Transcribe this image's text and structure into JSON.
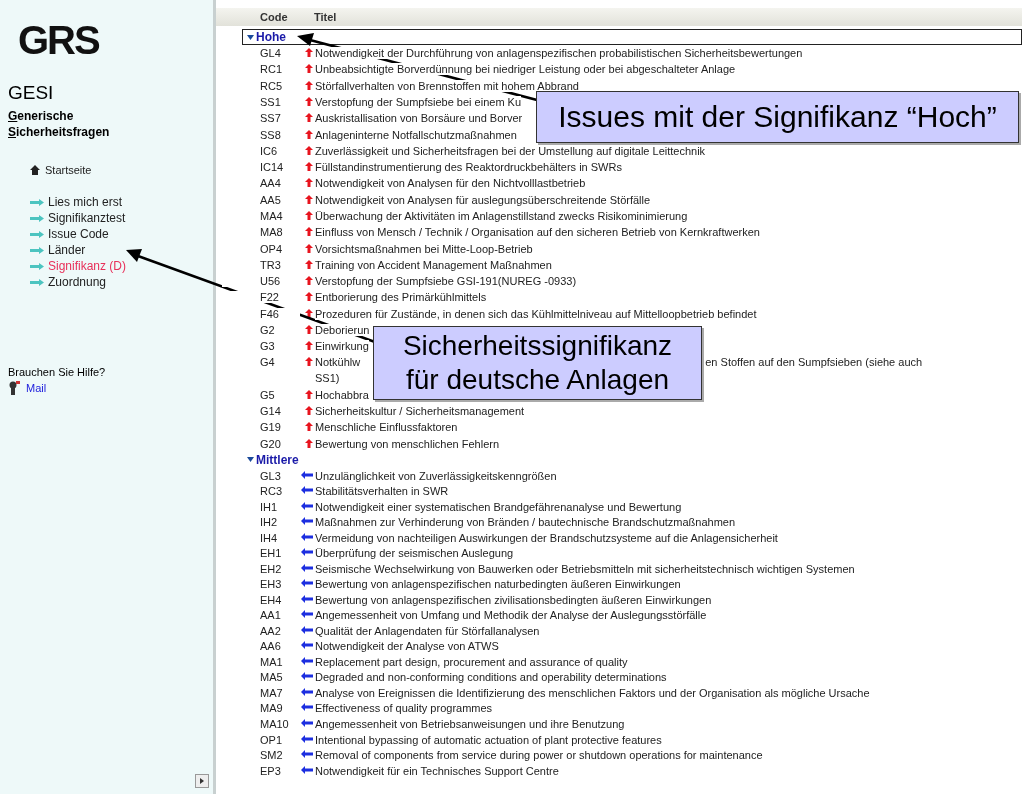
{
  "sidebar": {
    "logo": "GRS",
    "app_title": "GESI",
    "subtitle": [
      {
        "key": "G",
        "rest": "enerische"
      },
      {
        "key": "S",
        "rest": "icherheitsfragen"
      }
    ],
    "home": {
      "label": "Startseite"
    },
    "nav_items": [
      {
        "label": "Lies mich erst",
        "selected": false
      },
      {
        "label": "Signifikanztest",
        "selected": false
      },
      {
        "label": "Issue Code",
        "selected": false
      },
      {
        "label": "Länder",
        "selected": false
      },
      {
        "label": "Signifikanz (D)",
        "selected": true
      },
      {
        "label": "Zuordnung",
        "selected": false
      }
    ],
    "help": {
      "question": "Brauchen Sie Hilfe?",
      "link": "Mail"
    }
  },
  "table": {
    "columns": [
      "Code",
      "Titel"
    ],
    "groups": [
      {
        "label": "Hohe",
        "kind": "high",
        "selected": true,
        "rows": [
          {
            "code": "GL4",
            "title": "Notwendigkeit der Durchführung von anlagenspezifischen probabilistischen Sicherheitsbewertungen"
          },
          {
            "code": "RC1",
            "title": "Unbeabsichtigte Borverdünnung bei niedriger Leistung oder bei abgeschalteter Anlage"
          },
          {
            "code": "RC5",
            "title": "Störfallverhalten von Brennstoffen mit hohem Abbrand"
          },
          {
            "code": "SS1",
            "title": "Verstopfung der Sumpfsiebe bei einem Ku"
          },
          {
            "code": "SS7",
            "title": "Auskristallisation von Borsäure und Borver"
          },
          {
            "code": "SS8",
            "title": "Anlageninterne Notfallschutzmaßnahmen"
          },
          {
            "code": "IC6",
            "title": "Zuverlässigkeit und Sicherheitsfragen bei der Umstellung auf digitale Leittechnik"
          },
          {
            "code": "IC14",
            "title": "Füllstandinstrumentierung des Reaktordruckbehälters in SWRs"
          },
          {
            "code": "AA4",
            "title": "Notwendigkeit von Analysen für den Nichtvolllastbetrieb"
          },
          {
            "code": "AA5",
            "title": "Notwendigkeit von  Analysen für auslegungsüberschreitende Störfälle"
          },
          {
            "code": "MA4",
            "title": "Überwachung der Aktivitäten im Anlagenstillstand zwecks Risikominimierung"
          },
          {
            "code": "MA8",
            "title": "Einfluss von Mensch / Technik / Organisation auf den sicheren Betrieb von Kernkraftwerken"
          },
          {
            "code": "OP4",
            "title": "Vorsichtsmaßnahmen bei Mitte-Loop-Betrieb"
          },
          {
            "code": "TR3",
            "title": "Training von Accident Management Maßnahmen"
          },
          {
            "code": "U56",
            "title": "Verstopfung der Sumpfsiebe GSI-191(NUREG -0933)"
          },
          {
            "code": "F22",
            "title": "Entborierung des Primärkühlmittels"
          },
          {
            "code": "F46",
            "title": "Prozeduren für Zustände, in denen sich das Kühlmittelniveau auf Mittelloopbetrieb befindet"
          },
          {
            "code": "G2",
            "title": "Deborierun"
          },
          {
            "code": "G3",
            "title": "Einwirkung"
          },
          {
            "code": "G4",
            "title": "Notkühlw",
            "title_after": [
              "en Stoffen auf den Sumpfsieben (siehe auch",
              "SS1)"
            ]
          },
          {
            "code": "G5",
            "title": "Hochabbra"
          },
          {
            "code": "G14",
            "title": "Sicherheitskultur / Sicherheitsmanagement"
          },
          {
            "code": "G19",
            "title": "Menschliche Einflussfaktoren"
          },
          {
            "code": "G20",
            "title": "Bewertung von menschlichen Fehlern"
          }
        ]
      },
      {
        "label": "Mittlere",
        "kind": "medium",
        "selected": false,
        "rows": [
          {
            "code": "GL3",
            "title": "Unzulänglichkeit von Zuverlässigkeitskenngrößen"
          },
          {
            "code": "RC3",
            "title": "Stabilitätsverhalten in SWR"
          },
          {
            "code": "IH1",
            "title": "Notwendigkeit einer systematischen Brandgefährenanalyse und Bewertung"
          },
          {
            "code": "IH2",
            "title": "Maßnahmen zur Verhinderung von Bränden /  bautechnische Brandschutzmaßnahmen"
          },
          {
            "code": "IH4",
            "title": "Vermeidung von nachteiligen Auswirkungen der Brandschutzsysteme auf die Anlagensicherheit"
          },
          {
            "code": "EH1",
            "title": "Überprüfung der seismischen Auslegung"
          },
          {
            "code": "EH2",
            "title": "Seismische Wechselwirkung von Bauwerken oder Betriebsmitteln mit sicherheitstechnisch wichtigen Systemen"
          },
          {
            "code": "EH3",
            "title": "Bewertung von anlagenspezifischen naturbedingten äußeren Einwirkungen"
          },
          {
            "code": "EH4",
            "title": "Bewertung von anlagenspezifischen zivilisationsbedingten äußeren Einwirkungen"
          },
          {
            "code": "AA1",
            "title": "Angemessenheit von Umfang und Methodik der Analyse der Auslegungsstörfälle"
          },
          {
            "code": "AA2",
            "title": "Qualität der Anlagendaten für Störfallanalysen"
          },
          {
            "code": "AA6",
            "title": "Notwendigkeit der Analyse von ATWS"
          },
          {
            "code": "MA1",
            "title": "Replacement part design, procurement and assurance of quality"
          },
          {
            "code": "MA5",
            "title": "Degraded and non-conforming conditions and operability determinations"
          },
          {
            "code": "MA7",
            "title": "Analyse von Ereignissen  die Identifizierung des menschlichen Faktors und der Organisation als mögliche Ursache"
          },
          {
            "code": "MA9",
            "title": "Effectiveness of quality programmes"
          },
          {
            "code": "MA10",
            "title": "Angemessenheit von Betriebsanweisungen und ihre Benutzung"
          },
          {
            "code": "OP1",
            "title": "Intentional bypassing of automatic actuation of plant protective features"
          },
          {
            "code": "SM2",
            "title": "Removal of components from service during power or shutdown operations for maintenance"
          },
          {
            "code": "EP3",
            "title": "Notwendigkeit für ein Technisches Support Centre"
          }
        ]
      }
    ]
  },
  "callouts": [
    {
      "lines": [
        "Issues mit der Signifikanz “Hoch”"
      ]
    },
    {
      "lines": [
        "Sicherheitssignifikanz",
        "für deutsche Anlagen"
      ]
    }
  ]
}
